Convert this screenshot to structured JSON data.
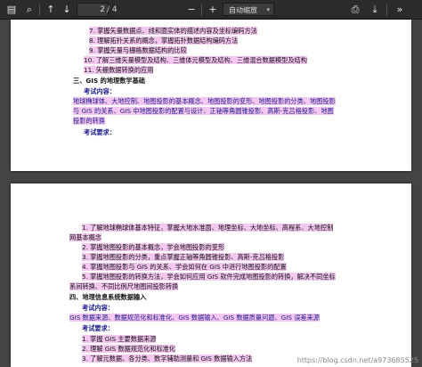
{
  "toolbar": {
    "sidebar_icon": "sidebar-toggle-icon",
    "search_icon": "search-icon",
    "prev_icon": "arrow-up-icon",
    "next_icon": "arrow-down-icon",
    "page_value": "2",
    "page_total": "/ 4",
    "zoom_out_icon": "minus-icon",
    "zoom_in_icon": "plus-icon",
    "zoom_label": "自动缩放",
    "print_icon": "print-icon",
    "download_icon": "save-icon",
    "tools_icon": "double-chevron-icon"
  },
  "page1": {
    "lines": [
      "7.  掌握矢量数据点、线和面实体的描述内容及坐标编码方法",
      "8.  理解拓扑关系的概念，掌握拓扑数据结构编码方法",
      "9.  掌握矢量与栅格数据结构的比较",
      "10.  了解三维矢量模型及结构、三维体元模型及结构、三维混合数据模型及结构",
      "11.  矢栅数据转换的应用",
      "三、GIS 的地理数学基础",
      "考试内容：",
      "地球椭球体、大地控制、地图投影的基本概念、地图投影的变形、地图投影的分类、地图投影",
      "与 GIS 的关系、GIS 中地图投影的配置与设计、正轴等角圆锥投影、高斯-克吕格投影、地图",
      "投影的转换",
      "考试要求："
    ]
  },
  "page2": {
    "lines": [
      "1.  了解地球椭球体基本特征，掌握大地水准面、地理坐标、大地坐标、高程系、大地控制",
      "网基本概念",
      "2.  掌握地图投影的基本概念，学会地图投影的变形",
      "3.  掌握地图投影的分类，重点掌握正轴等角圆锥投影、高斯-克吕格投影",
      "4.  掌握地图投影与 GIS 的关系、学会如何在 GIS 中进行地图投影的配置",
      "5.  掌握地图投影的转换方法，学会如何应用 GIS 软件完成地图投影的转换，解决不同坐标",
      "系间转换、不同比例尺地图间投影转换",
      "四、地理信息系统数据输入",
      "考试内容：",
      "GIS 数据来源、数据规范化和标准化、GIS 数据输入、GIS 数据质量问题、GIS 误差来源",
      "考试要求：",
      "1.  掌握 GIS 主要数据来源",
      "2.  理解 GIS 数据规范化和标准化",
      "3.  了解元数据、各分类、数字辅助测量和 GIS 数据输入方法"
    ]
  },
  "watermark": "https://blog.csdn.net/a973685525"
}
